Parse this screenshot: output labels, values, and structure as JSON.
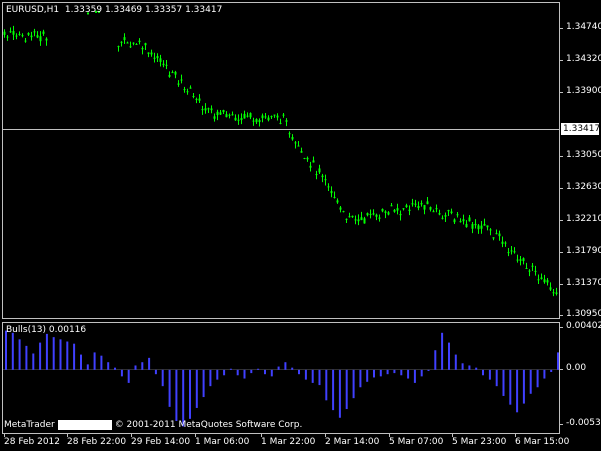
{
  "chart_title": {
    "symbol": "EURUSD,H1",
    "ohlc": "1.33359 1.33469 1.33357 1.33417"
  },
  "indicator_title": {
    "name": "Bulls(13)",
    "value": "0.00116"
  },
  "current_price_marker": "1.33417",
  "copyright": {
    "brand": "MetaTrader",
    "text": "© 2001-2011 MetaQuotes Software Corp."
  },
  "price_axis": [
    "1.34740",
    "1.34320",
    "1.33900",
    "1.33050",
    "1.32630",
    "1.32210",
    "1.31790",
    "1.31370",
    "1.30950"
  ],
  "indicator_axis": [
    "0.00402",
    "0.00",
    "-0.00532"
  ],
  "time_axis": [
    "28 Feb 2012",
    "28 Feb 22:00",
    "29 Feb 14:00",
    "1 Mar 06:00",
    "1 Mar 22:00",
    "2 Mar 14:00",
    "5 Mar 07:00",
    "5 Mar 23:00",
    "6 Mar 15:00"
  ],
  "colors": {
    "background": "#000000",
    "candle_up": "#00ff00",
    "bulls_histogram": "#4040ff",
    "grid_lines": "#c0c0c0",
    "text": "#ffffff"
  },
  "chart_data": [
    {
      "type": "line",
      "title": "EURUSD,H1",
      "series": [
        {
          "name": "",
          "x": [
            "28 Feb 2012",
            "28 Feb 22:00",
            "29 Feb 14:00",
            "1 Mar 06:00",
            "1 Mar 22:00",
            "2 Mar 14:00",
            "5 Mar 07:00",
            "5 Mar 23:00",
            "6 Mar 15:00"
          ],
          "values": [
            1.3443,
            1.3435,
            1.343,
            1.334,
            1.3335,
            1.3205,
            1.3225,
            1.3195,
            1.311
          ]
        }
      ],
      "ylim": [
        1.3081,
        1.3481
      ],
      "current": 1.33417
    },
    {
      "type": "bar",
      "title": "Bulls(13)",
      "series": [
        {
          "name": "Bulls(13)",
          "values": [
            0.0036,
            0.0034,
            0.0028,
            0.0022,
            0.0015,
            0.0025,
            0.0033,
            0.003,
            0.0028,
            0.0026,
            0.0024,
            0.0014,
            0.0005,
            0.0016,
            0.0013,
            0.0007,
            0.0002,
            -0.0006,
            -0.0012,
            0.0004,
            0.0007,
            0.0011,
            -0.0004,
            -0.0015,
            -0.0034,
            -0.0047,
            -0.0052,
            -0.0045,
            -0.0035,
            -0.0025,
            -0.0015,
            -0.0009,
            -0.0005,
            0.0001,
            -0.0005,
            -0.0008,
            -0.0003,
            0.0001,
            -0.0004,
            -0.0006,
            0.0003,
            0.0007,
            0.0002,
            -0.0004,
            -0.0009,
            -0.0012,
            -0.0014,
            -0.0028,
            -0.0037,
            -0.0044,
            -0.0036,
            -0.0026,
            -0.0016,
            -0.0011,
            -0.0007,
            -0.0006,
            -0.0004,
            -0.0003,
            -0.0005,
            -0.0008,
            -0.0012,
            -0.0006,
            -0.0001,
            0.0018,
            0.0034,
            0.0025,
            0.0014,
            0.0006,
            0.0004,
            0.0002,
            -0.0005,
            -0.0009,
            -0.0015,
            -0.0024,
            -0.0032,
            -0.0039,
            -0.0031,
            -0.0022,
            -0.0016,
            -0.0008,
            -0.0002,
            0.0016
          ]
        }
      ],
      "ylim": [
        -0.0058,
        0.0043
      ]
    }
  ]
}
